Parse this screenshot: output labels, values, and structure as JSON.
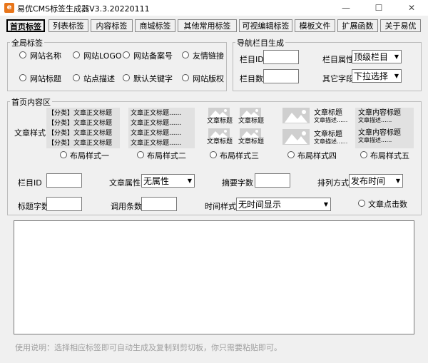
{
  "window": {
    "title": "易优CMS标签生成器V3.3.20220111",
    "min_glyph": "—",
    "max_glyph": "☐",
    "close_glyph": "✕"
  },
  "tabs": [
    "首页标签",
    "列表标签",
    "内容标签",
    "商城标签",
    "其他常用标签",
    "可视编辑标签",
    "模板文件",
    "扩展函数",
    "关于易优"
  ],
  "global_tags": {
    "legend": "全局标签",
    "options": [
      "网站名称",
      "网站LOGO",
      "网站备案号",
      "友情链接",
      "网站标题",
      "站点描述",
      "默认关键字",
      "网站版权"
    ]
  },
  "nav_gen": {
    "legend": "导航栏目生成",
    "column_id_label": "栏目ID",
    "column_count_label": "栏目数",
    "column_attr_label": "栏目属性",
    "column_attr_value": "顶级栏目",
    "other_field_label": "其它字段",
    "other_field_value": "下拉选择"
  },
  "home_content": {
    "legend": "首页内容区",
    "article_style_label": "文章样式",
    "layout1_lines": [
      "【分类】文章正文标题",
      "【分类】文章正文标题",
      "【分类】文章正文标题",
      "【分类】文章正文标题"
    ],
    "layout2_lines": [
      "文章正文标题......",
      "文章正文标题......",
      "文章正文标题......",
      "文章正文标题......"
    ],
    "layout3_caption": "文章标题",
    "layout4_title": "文章标题",
    "layout4_desc": "文章描述......",
    "layout5_title": "文章内容标题",
    "layout5_desc": "文章描述......",
    "layouts": [
      "布局样式一",
      "布局样式二",
      "布局样式三",
      "布局样式四",
      "布局样式五"
    ],
    "column_id_label": "栏目ID",
    "article_attr_label": "文章属性",
    "article_attr_value": "无属性",
    "summary_chars_label": "摘要字数",
    "sort_label": "排列方式",
    "sort_value": "发布时间",
    "title_chars_label": "标题字数",
    "call_count_label": "调用条数",
    "time_style_label": "时间样式",
    "time_style_value": "无时间显示",
    "article_clicks_label": "文章点击数"
  },
  "footer": "使用说明：选择相应标签即可自动生成及复制到剪切板，你只需要粘贴即可。"
}
